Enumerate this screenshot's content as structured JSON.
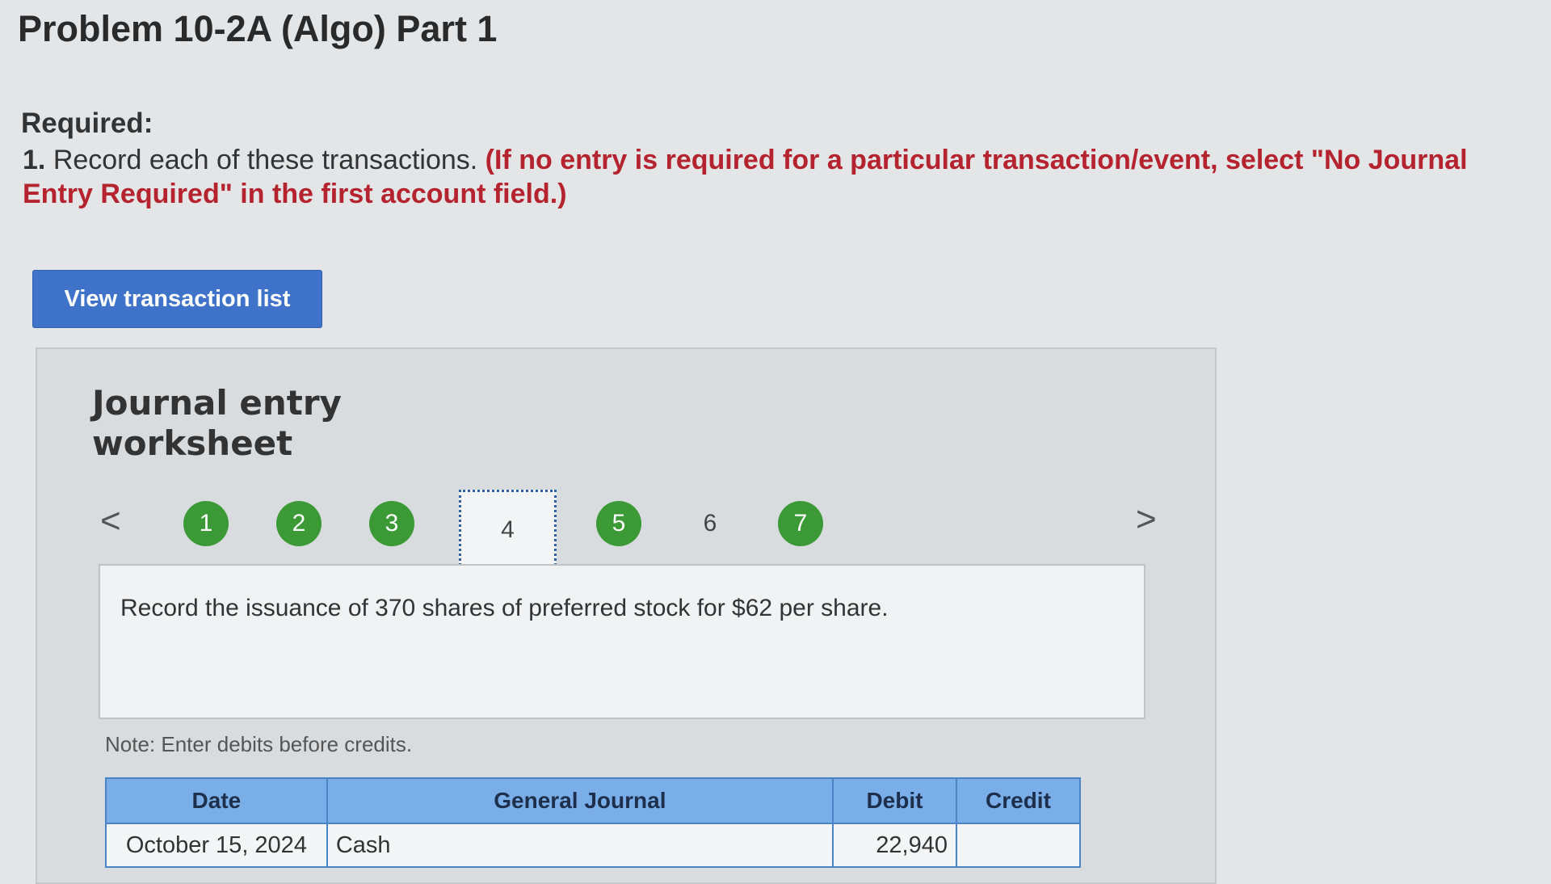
{
  "header": {
    "title": "Problem 10-2A (Algo) Part 1"
  },
  "instructions": {
    "required_label": "Required:",
    "item_number": "1.",
    "item_text": "Record each of these transactions.",
    "item_note": "(If no entry is required for a particular transaction/event, select \"No Journal Entry Required\" in the first account field.)"
  },
  "toolbar": {
    "view_transaction_list_label": "View transaction list"
  },
  "worksheet": {
    "title_line1": "Journal entry",
    "title_line2": "worksheet",
    "prev_arrow": "<",
    "next_arrow": ">",
    "steps": [
      {
        "label": "1",
        "status": "completed"
      },
      {
        "label": "2",
        "status": "completed"
      },
      {
        "label": "3",
        "status": "completed"
      },
      {
        "label": "4",
        "status": "current"
      },
      {
        "label": "5",
        "status": "completed"
      },
      {
        "label": "6",
        "status": "pending"
      },
      {
        "label": "7",
        "status": "completed"
      }
    ],
    "description": "Record the issuance of 370 shares of preferred stock for $62 per share.",
    "note": "Note: Enter debits before credits.",
    "table": {
      "headers": {
        "date": "Date",
        "general_journal": "General Journal",
        "debit": "Debit",
        "credit": "Credit"
      },
      "rows": [
        {
          "date": "October 15, 2024",
          "account": "Cash",
          "debit": "22,940",
          "credit": ""
        }
      ]
    }
  },
  "colors": {
    "background": "#e3e5e7",
    "button_blue": "#3f73c9",
    "step_green": "#3c9a36",
    "note_red": "#b5232f",
    "table_header": "#7aaee8"
  }
}
